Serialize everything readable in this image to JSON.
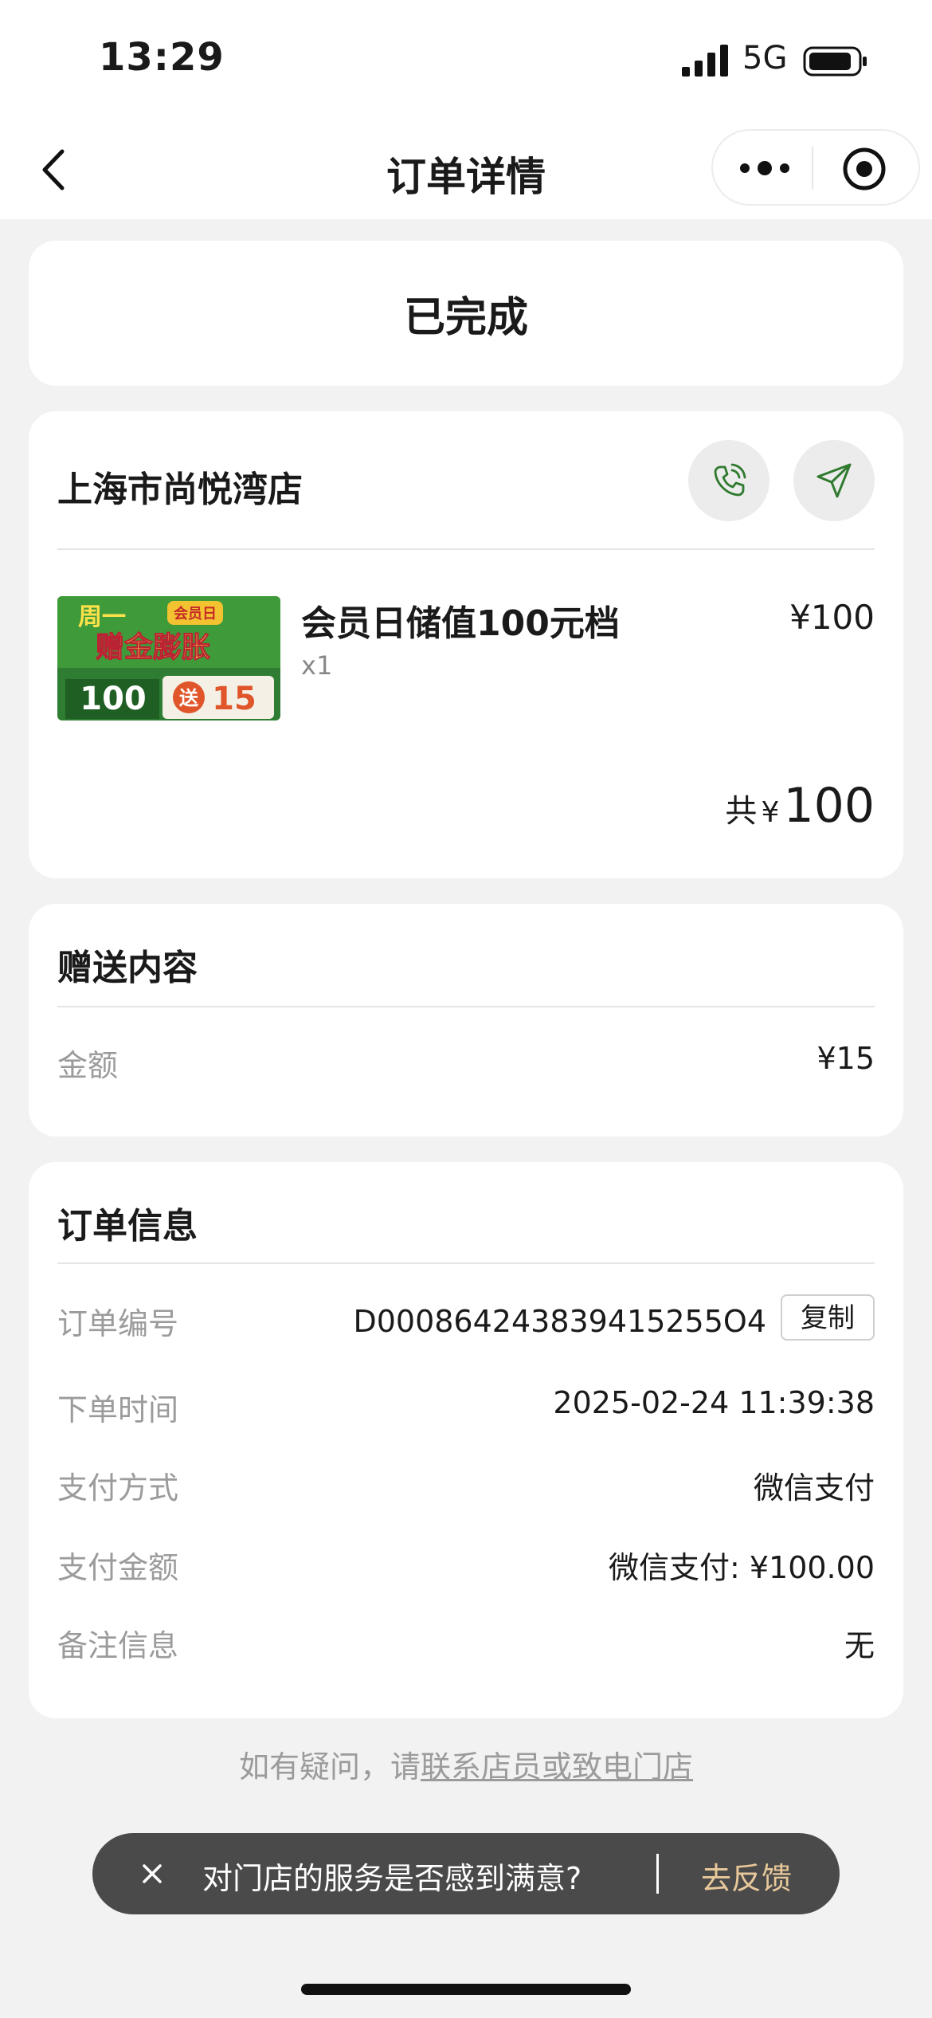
{
  "status_bar": {
    "time": "13:29",
    "network": "5G",
    "signal": "signal-icon",
    "battery": "battery-icon"
  },
  "nav": {
    "title": "订单详情",
    "back": "chevron-left-icon",
    "more": "more-dots-icon",
    "close": "target-close-icon"
  },
  "status_card": {
    "status": "已完成"
  },
  "store": {
    "name": "上海市尚悦湾店",
    "phone_icon": "phone-icon",
    "nav_icon": "navigation-arrow-icon",
    "product": {
      "name": "会员日储值100元档",
      "qty": "x1",
      "price": "¥100",
      "image_text": {
        "line1": "周一",
        "badge": "会员日",
        "line2": "赠金膨胀",
        "left": "100",
        "right_prefix": "送",
        "right_num": "15"
      }
    },
    "total": {
      "label": "共",
      "yen": "¥",
      "amount": "100"
    }
  },
  "gift": {
    "title": "赠送内容",
    "rows": [
      {
        "label": "金额",
        "value": "¥15"
      }
    ]
  },
  "order_info": {
    "title": "订单信息",
    "number_label": "订单编号",
    "number_value": "D000864243839415255O4",
    "copy_label": "复制",
    "time_label": "下单时间",
    "time_value": "2025-02-24 11:39:38",
    "pay_method_label": "支付方式",
    "pay_method_value": "微信支付",
    "pay_amount_label": "支付金额",
    "pay_amount_value": "微信支付: ¥100.00",
    "remark_label": "备注信息",
    "remark_value": "无"
  },
  "help": {
    "prefix": "如有疑问，请",
    "link": "联系店员或致电门店"
  },
  "toast": {
    "question": "对门店的服务是否感到满意?",
    "action": "去反馈"
  },
  "colors": {
    "accent": "#2f7a2f",
    "toast_bg": "#4a4a4a",
    "toast_action": "#e8c89a"
  }
}
